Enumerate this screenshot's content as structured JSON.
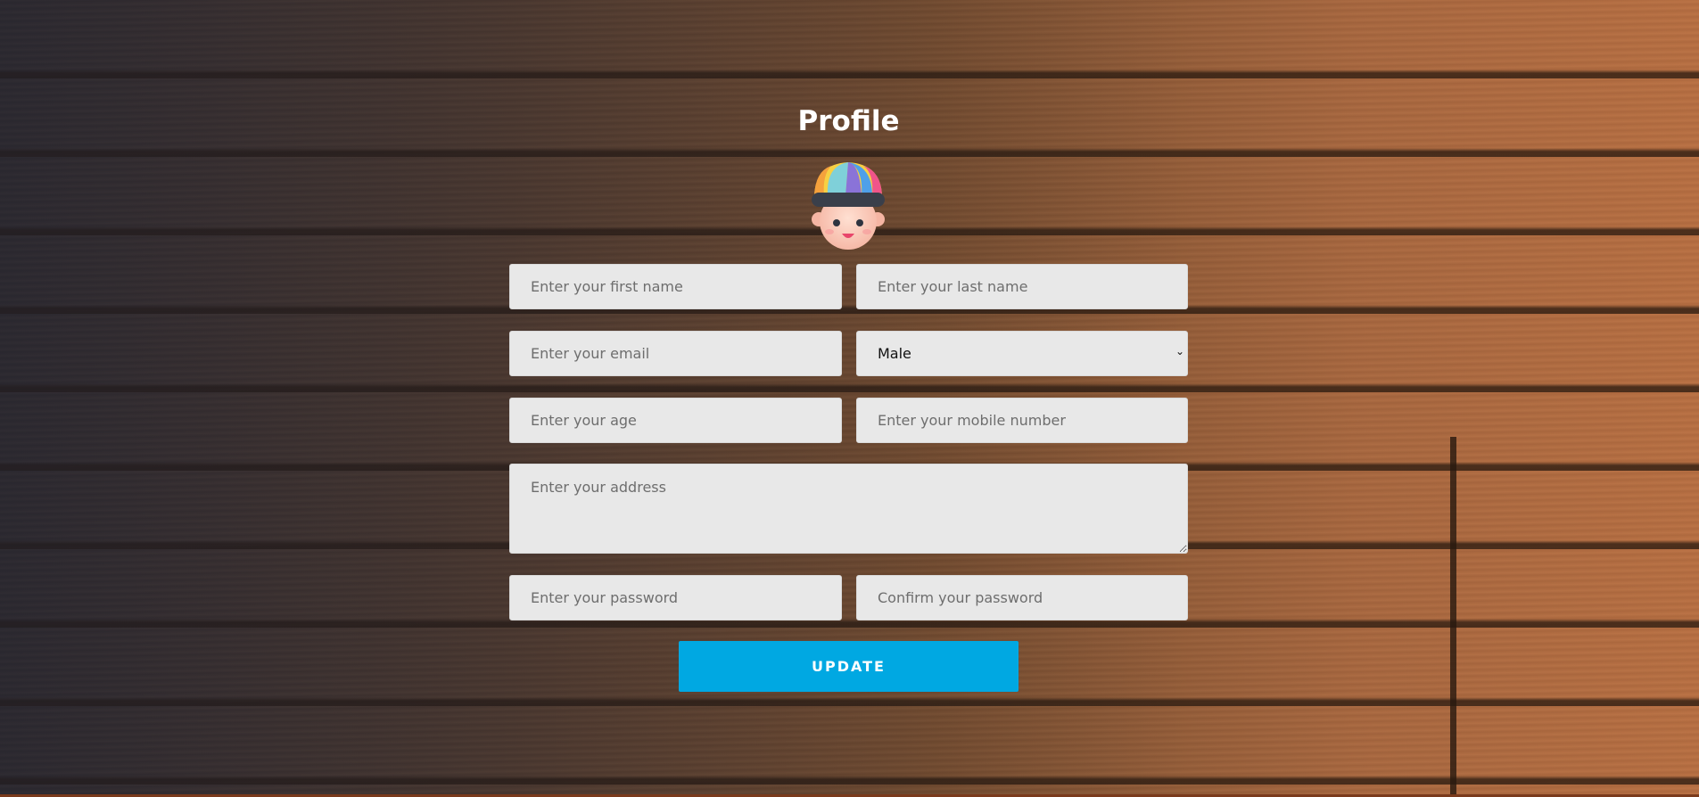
{
  "page": {
    "title": "Profile"
  },
  "avatar": {
    "icon": "avatar-icon"
  },
  "form": {
    "first_name": {
      "placeholder": "Enter your first name",
      "value": ""
    },
    "last_name": {
      "placeholder": "Enter your last name",
      "value": ""
    },
    "email": {
      "placeholder": "Enter your email",
      "value": ""
    },
    "gender": {
      "selected": "Male",
      "options": [
        "Male"
      ]
    },
    "age": {
      "placeholder": "Enter your age",
      "value": ""
    },
    "mobile": {
      "placeholder": "Enter your mobile number",
      "value": ""
    },
    "address": {
      "placeholder": "Enter your address",
      "value": ""
    },
    "password": {
      "placeholder": "Enter your password",
      "value": ""
    },
    "confirm_password": {
      "placeholder": "Confirm your password",
      "value": ""
    },
    "update_label": "UPDATE"
  },
  "colors": {
    "button": "#00a8e2",
    "field_bg": "#e8e8e8",
    "title": "#ffffff"
  }
}
